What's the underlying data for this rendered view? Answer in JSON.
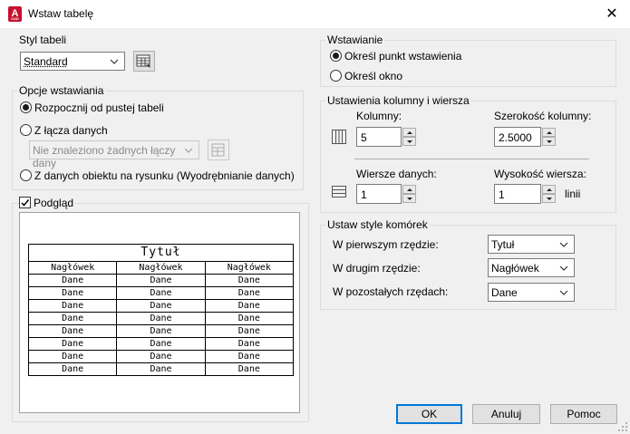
{
  "window": {
    "title": "Wstaw tabelę",
    "close": "✕"
  },
  "table_style": {
    "label": "Styl tabeli",
    "value": "Standard"
  },
  "insert_options": {
    "label": "Opcje wstawiania",
    "opt_empty": "Rozpocznij od pustej tabeli",
    "opt_link": "Z łącza danych",
    "link_combo": "Nie znaleziono żadnych łączy dany",
    "opt_object": "Z danych obiektu na rysunku (Wyodrębnianie danych)"
  },
  "preview": {
    "label": "Podgląd",
    "title": "Tytuł",
    "headers": [
      "Nagłówek",
      "Nagłówek",
      "Nagłówek"
    ],
    "rows": [
      [
        "Dane",
        "Dane",
        "Dane"
      ],
      [
        "Dane",
        "Dane",
        "Dane"
      ],
      [
        "Dane",
        "Dane",
        "Dane"
      ],
      [
        "Dane",
        "Dane",
        "Dane"
      ],
      [
        "Dane",
        "Dane",
        "Dane"
      ],
      [
        "Dane",
        "Dane",
        "Dane"
      ],
      [
        "Dane",
        "Dane",
        "Dane"
      ],
      [
        "Dane",
        "Dane",
        "Dane"
      ]
    ]
  },
  "insertion": {
    "label": "Wstawianie",
    "opt_point": "Określ punkt wstawienia",
    "opt_window": "Określ okno"
  },
  "col_row": {
    "label": "Ustawienia kolumny i wiersza",
    "columns_label": "Kolumny:",
    "columns_value": "5",
    "col_width_label": "Szerokość kolumny:",
    "col_width_value": "2.5000",
    "data_rows_label": "Wiersze danych:",
    "data_rows_value": "1",
    "row_height_label": "Wysokość wiersza:",
    "row_height_value": "1",
    "row_height_unit": "linii"
  },
  "cell_styles": {
    "label": "Ustaw style komórek",
    "first_row_label": "W pierwszym rzędzie:",
    "first_row_value": "Tytuł",
    "second_row_label": "W drugim rzędzie:",
    "second_row_value": "Nagłówek",
    "other_rows_label": "W pozostałych rzędach:",
    "other_rows_value": "Dane"
  },
  "buttons": {
    "ok": "OK",
    "cancel": "Anuluj",
    "help": "Pomoc"
  }
}
